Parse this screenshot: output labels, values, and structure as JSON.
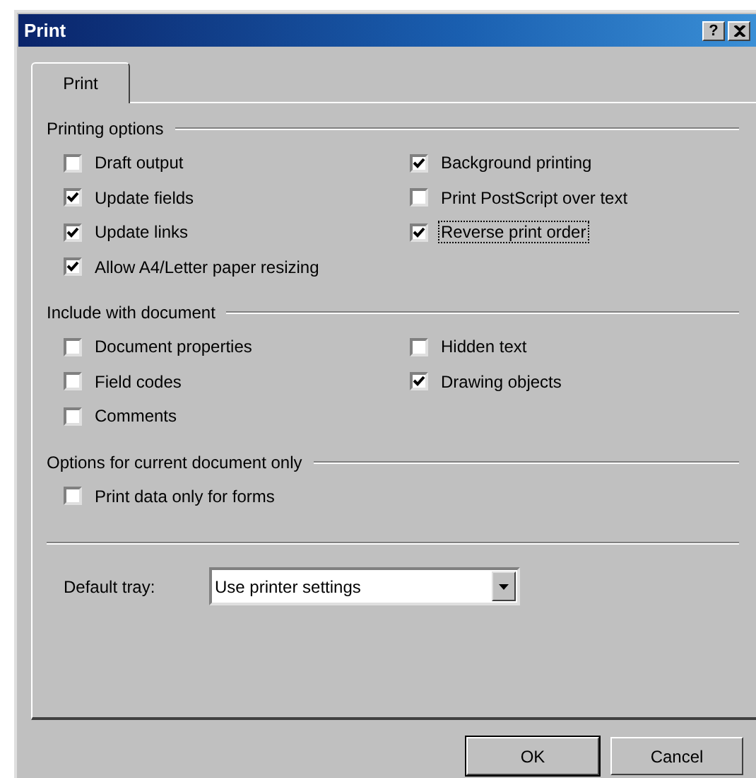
{
  "window": {
    "title": "Print",
    "help": "?"
  },
  "tabs": [
    {
      "label": "Print",
      "selected": true
    }
  ],
  "groups": [
    {
      "title": "Printing options",
      "columns": [
        [
          {
            "label": "Draft output",
            "checked": false,
            "focused": false
          },
          {
            "label": "Update fields",
            "checked": true,
            "focused": false
          },
          {
            "label": "Update links",
            "checked": true,
            "focused": false
          },
          {
            "label": "Allow A4/Letter paper resizing",
            "checked": true,
            "focused": false
          }
        ],
        [
          {
            "label": "Background printing",
            "checked": true,
            "focused": false
          },
          {
            "label": "Print PostScript over text",
            "checked": false,
            "focused": false
          },
          {
            "label": "Reverse print order",
            "checked": true,
            "focused": true
          }
        ]
      ]
    },
    {
      "title": "Include with document",
      "columns": [
        [
          {
            "label": "Document properties",
            "checked": false,
            "focused": false
          },
          {
            "label": "Field codes",
            "checked": false,
            "focused": false
          },
          {
            "label": "Comments",
            "checked": false,
            "focused": false
          }
        ],
        [
          {
            "label": "Hidden text",
            "checked": false,
            "focused": false
          },
          {
            "label": "Drawing objects",
            "checked": true,
            "focused": false
          }
        ]
      ]
    },
    {
      "title": "Options for current document only",
      "columns": [
        [
          {
            "label": "Print data only for forms",
            "checked": false,
            "focused": false
          }
        ]
      ]
    }
  ],
  "default_tray": {
    "label": "Default tray:",
    "value": "Use printer settings"
  },
  "buttons": [
    {
      "label": "OK",
      "default": true
    },
    {
      "label": "Cancel",
      "default": false
    }
  ]
}
